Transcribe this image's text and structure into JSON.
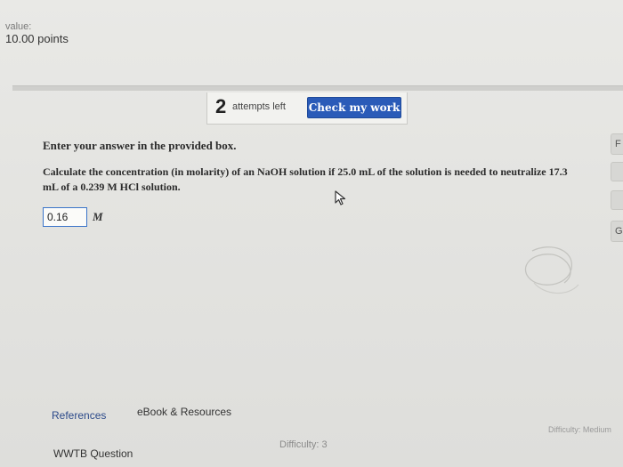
{
  "header": {
    "value_label": "value:",
    "points": "10.00 points"
  },
  "toolbar": {
    "attempts_number": "2",
    "attempts_text": "attempts left",
    "check_button": "Check my work"
  },
  "question": {
    "instruction": "Enter your answer in the provided box.",
    "prompt": "Calculate the concentration (in molarity) of an NaOH solution if 25.0 mL of the solution is needed to neutralize 17.3 mL of a 0.239 M HCl solution."
  },
  "answer": {
    "value": "0.16",
    "unit": "M"
  },
  "side_tabs": [
    "F",
    "G"
  ],
  "footer": {
    "references": "References",
    "ebook": "eBook & Resources",
    "wwtb": "WWTB Question",
    "difficulty": "Difficulty: 3",
    "difficulty_right": "Difficulty: Medium"
  }
}
